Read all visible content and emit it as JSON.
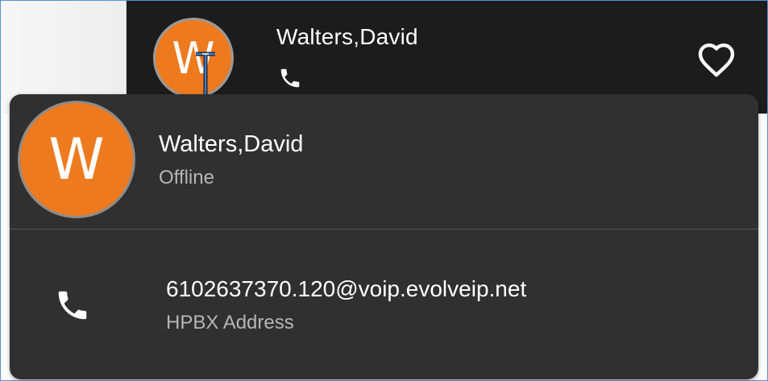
{
  "header": {
    "contact_name": "Walters,David",
    "avatar_initial": "W",
    "phone_icon": "phone-icon",
    "favorite_icon": "heart-outline-icon"
  },
  "popup": {
    "avatar_initial": "W",
    "contact_name": "Walters,David",
    "status": "Offline",
    "contact_method": {
      "icon": "phone-icon",
      "address": "6102637370.120@voip.evolveip.net",
      "label": "HPBX Address"
    }
  },
  "colors": {
    "avatar": "#ee7a1f",
    "header_bg": "#1c1c1c",
    "popup_bg": "#303030",
    "primary_text": "#ffffff",
    "secondary_text": "#b6b6b6"
  }
}
